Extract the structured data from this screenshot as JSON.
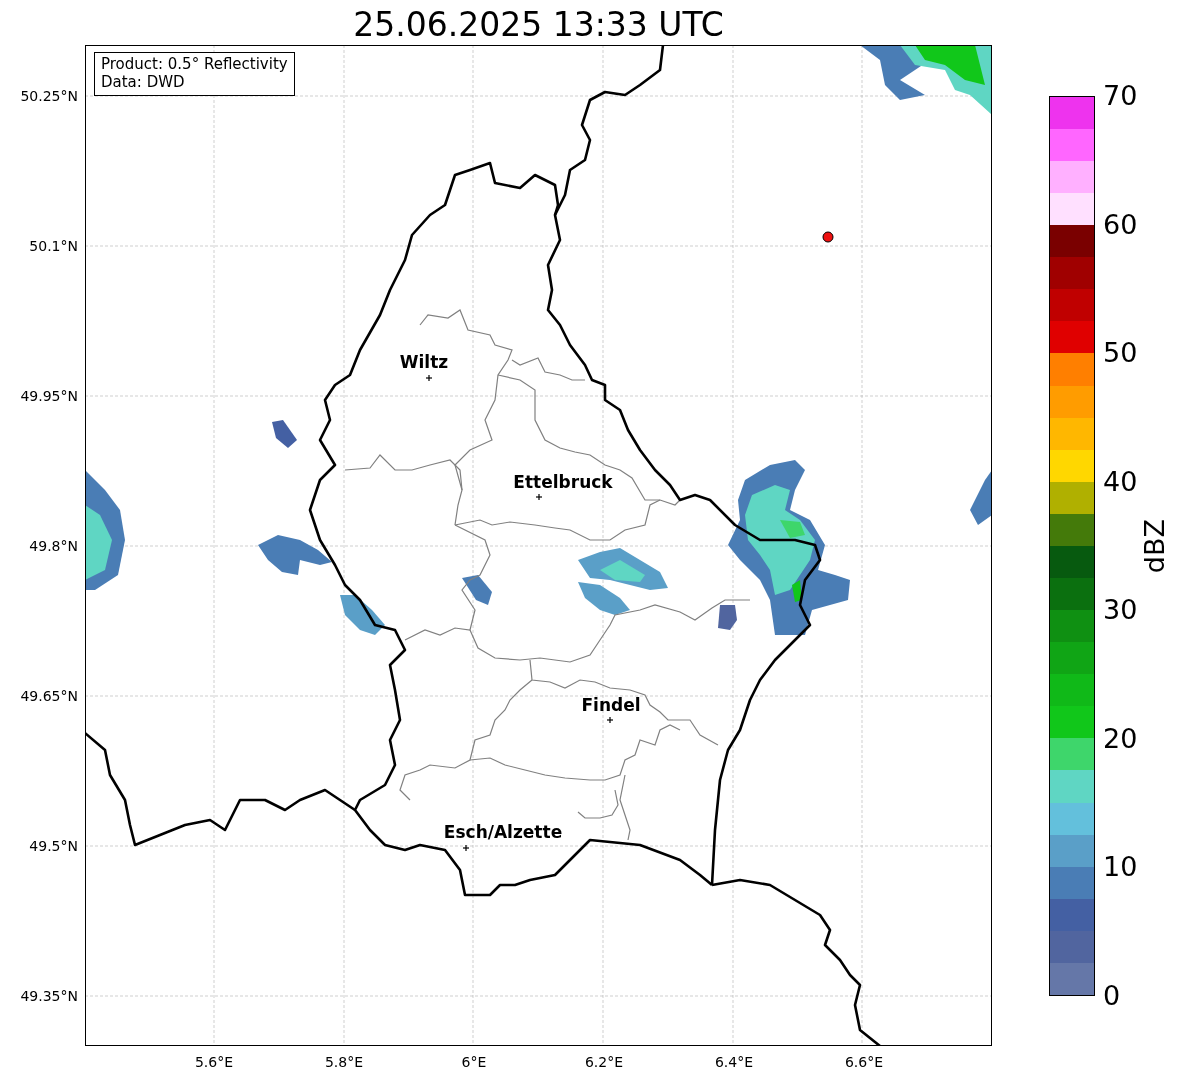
{
  "title": "25.06.2025 13:33 UTC",
  "info_box": {
    "lines": [
      "Product: 0.5° Reflectivity",
      "Data: DWD"
    ]
  },
  "map": {
    "lat_ticks": [
      "50.25°N",
      "50.1°N",
      "49.95°N",
      "49.8°N",
      "49.65°N",
      "49.5°N",
      "49.35°N"
    ],
    "lon_ticks": [
      "5.6°E",
      "5.8°E",
      "6°E",
      "6.2°E",
      "6.4°E",
      "6.6°E"
    ],
    "cities": [
      {
        "name": "Wiltz"
      },
      {
        "name": "Ettelbruck"
      },
      {
        "name": "Findel"
      },
      {
        "name": "Esch/Alzette"
      }
    ]
  },
  "colorbar": {
    "label": "dBZ",
    "ticks": [
      "70",
      "60",
      "50",
      "40",
      "30",
      "20",
      "10",
      "0"
    ],
    "segments": [
      {
        "color": "#6577a8"
      },
      {
        "color": "#51659f"
      },
      {
        "color": "#4460a3"
      },
      {
        "color": "#4a7db5"
      },
      {
        "color": "#5a9fc8"
      },
      {
        "color": "#63c0dc"
      },
      {
        "color": "#5fd6c3"
      },
      {
        "color": "#3ed66b"
      },
      {
        "color": "#11c71a"
      },
      {
        "color": "#10b918"
      },
      {
        "color": "#10a515"
      },
      {
        "color": "#0f9012"
      },
      {
        "color": "#0b700f"
      },
      {
        "color": "#075a0f"
      },
      {
        "color": "#447a0a"
      },
      {
        "color": "#b0b000"
      },
      {
        "color": "#ffd700"
      },
      {
        "color": "#ffb700"
      },
      {
        "color": "#ff9c00"
      },
      {
        "color": "#ff7f00"
      },
      {
        "color": "#e00000"
      },
      {
        "color": "#c00000"
      },
      {
        "color": "#a00000"
      },
      {
        "color": "#7a0000"
      },
      {
        "color": "#ffe0ff"
      },
      {
        "color": "#ffb0ff"
      },
      {
        "color": "#ff66ff"
      },
      {
        "color": "#ee33ee"
      }
    ]
  }
}
